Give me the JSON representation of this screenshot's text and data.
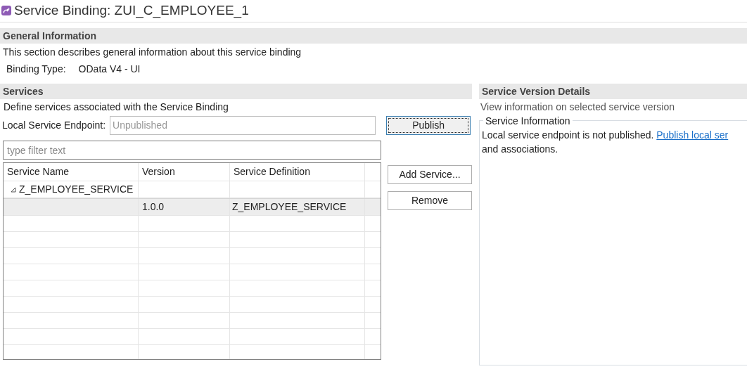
{
  "title": "Service Binding: ZUI_C_EMPLOYEE_1",
  "general": {
    "heading": "General Information",
    "description": "This section describes general information about this service binding",
    "binding_type_label": "Binding Type:",
    "binding_type": "OData V4 - UI"
  },
  "services": {
    "heading": "Services",
    "description": "Define services associated with the Service Binding",
    "endpoint_label": "Local Service Endpoint:",
    "endpoint_placeholder": "Unpublished",
    "publish_button": "Publish",
    "filter_placeholder": "type filter text",
    "columns": [
      "Service Name",
      "Version",
      "Service Definition"
    ],
    "rows": [
      {
        "name": "Z_EMPLOYEE_SERVICE",
        "expanded": true,
        "selected": false,
        "children": [
          {
            "version": "1.0.0",
            "definition": "Z_EMPLOYEE_SERVICE",
            "selected": true
          }
        ]
      }
    ],
    "buttons": [
      "Add Service...",
      "Remove"
    ]
  },
  "details": {
    "heading": "Service Version Details",
    "description": "View information on selected service version",
    "group_title": "Service Information",
    "message": "Local service endpoint is not published.",
    "link": "Publish local ser",
    "message_end": "and associations."
  }
}
